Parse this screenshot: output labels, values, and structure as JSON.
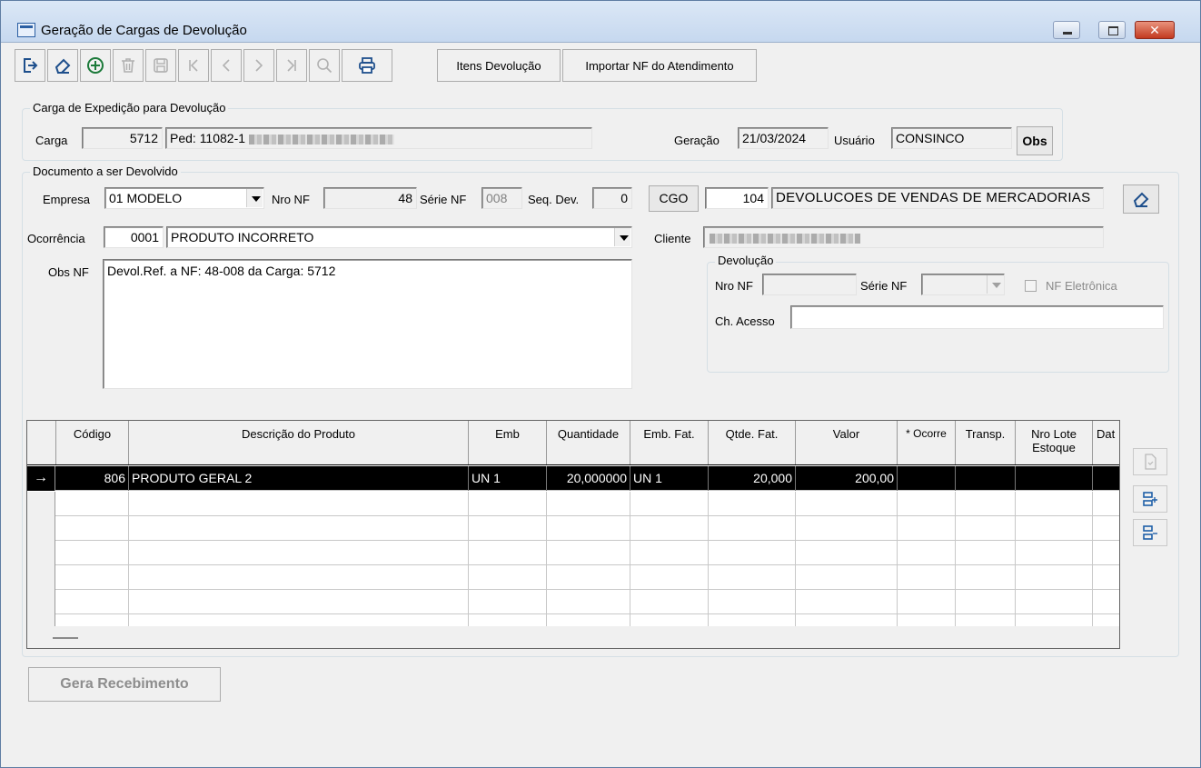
{
  "window": {
    "title": "Geração de Cargas de Devolução",
    "close_label": "✕"
  },
  "toolbar": {
    "icons": [
      "exit-icon",
      "eraser-icon",
      "add-icon",
      "delete-icon",
      "save-icon",
      "first-icon",
      "previous-icon",
      "next-icon",
      "last-icon",
      "search-icon",
      "print-icon"
    ],
    "itens_devolucao_label": "Itens Devolução",
    "importar_nf_label": "Importar NF do Atendimento"
  },
  "carga_group": {
    "legend": "Carga de Expedição para Devolução",
    "carga_label": "Carga",
    "carga_value": "5712",
    "pedido_value": "Ped: 11082-1",
    "geracao_label": "Geração",
    "geracao_value": "21/03/2024",
    "usuario_label": "Usuário",
    "usuario_value": "CONSINCO",
    "obs_button": "Obs"
  },
  "documento_group": {
    "legend": "Documento a ser Devolvido",
    "empresa_label": "Empresa",
    "empresa_value": "01 MODELO",
    "nro_nf_label": "Nro NF",
    "nro_nf_value": "48",
    "serie_nf_label": "Série NF",
    "serie_nf_value": "008",
    "seq_dev_label": "Seq. Dev.",
    "seq_dev_value": "0",
    "cgo_button": "CGO",
    "cgo_code": "104",
    "cgo_desc": "DEVOLUCOES DE VENDAS DE MERCADORIAS",
    "ocorrencia_label": "Ocorrência",
    "ocorrencia_code": "0001",
    "ocorrencia_desc": "PRODUTO INCORRETO",
    "cliente_label": "Cliente",
    "obs_nf_label": "Obs NF",
    "obs_nf_value": "Devol.Ref. a NF: 48-008 da Carga: 5712"
  },
  "devolucao_group": {
    "legend": "Devolução",
    "nro_nf_label": "Nro NF",
    "serie_nf_label": "Série NF",
    "nf_eletronica_label": "NF Eletrônica",
    "ch_acesso_label": "Ch. Acesso"
  },
  "grid": {
    "headers": [
      "Código",
      "Descrição do Produto",
      "Emb",
      "Quantidade",
      "Emb. Fat.",
      "Qtde. Fat.",
      "Valor",
      "* Ocorre",
      "Transp.",
      "Nro Lote Estoque",
      "Dat"
    ],
    "rows": [
      {
        "indicator": "→",
        "codigo": "806",
        "descricao": "PRODUTO GERAL 2",
        "emb": "UN 1",
        "quantidade": "20,000000",
        "emb_fat": "UN 1",
        "qtde_fat": "20,000",
        "valor": "200,00"
      }
    ]
  },
  "footer": {
    "gera_recebimento_label": "Gera Recebimento"
  }
}
